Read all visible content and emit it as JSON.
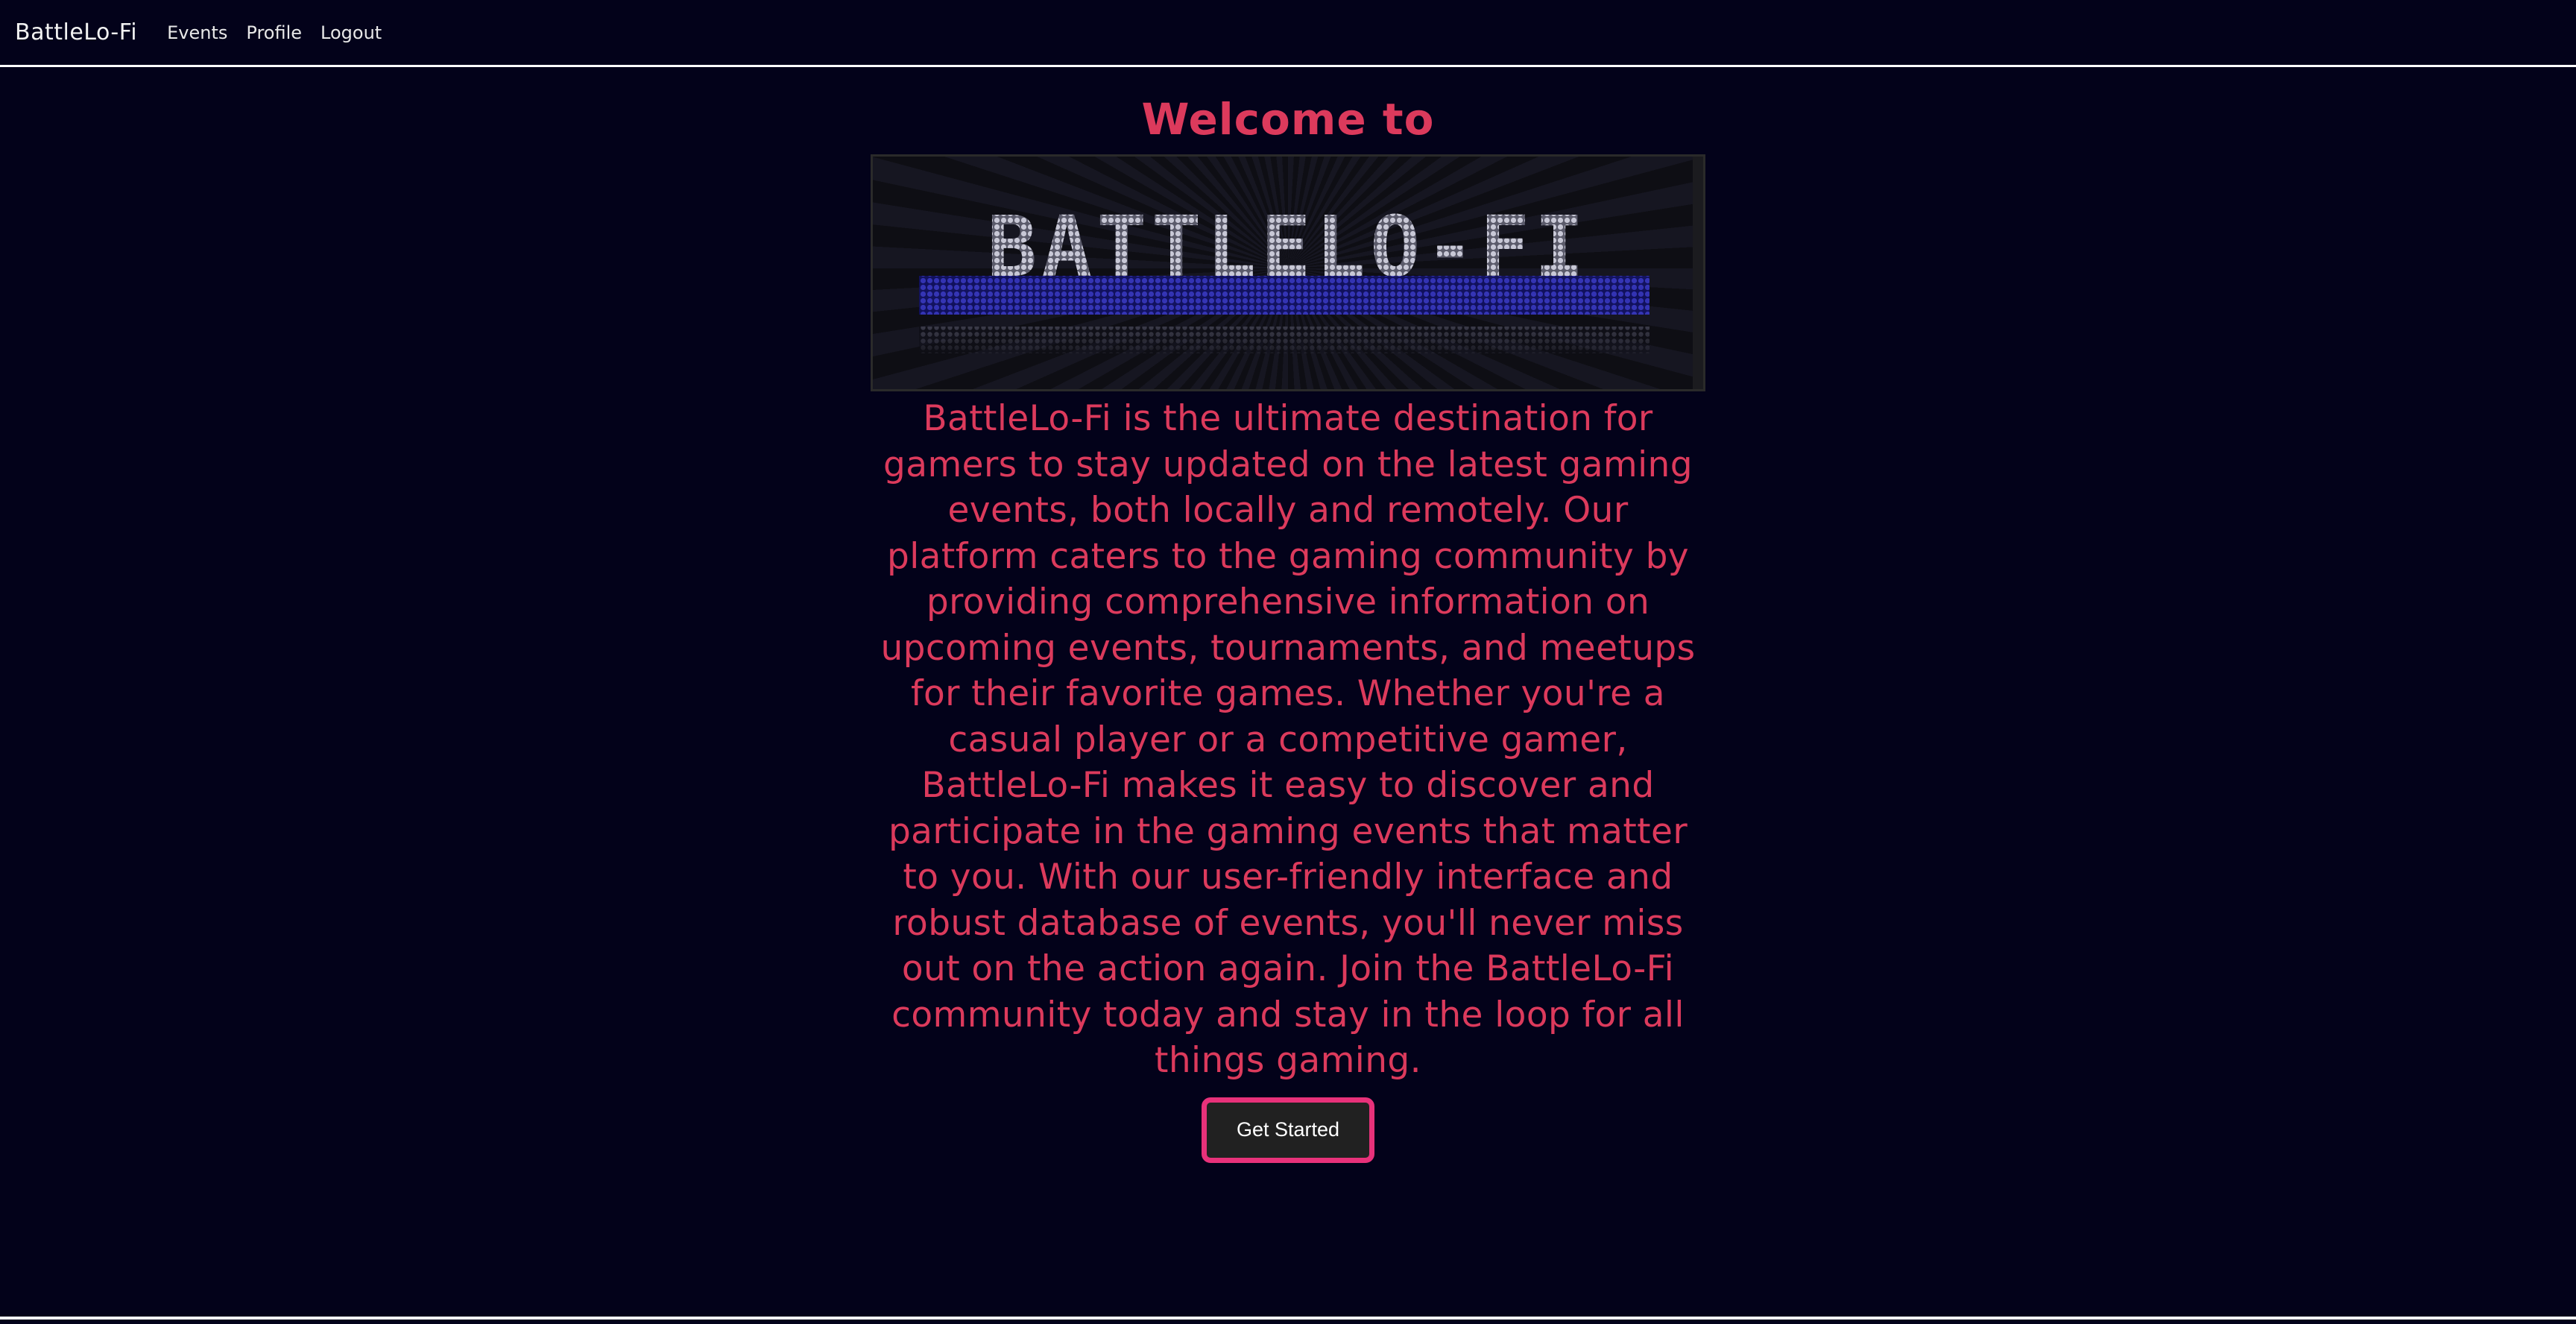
{
  "navbar": {
    "brand": "BattleLo-Fi",
    "links": [
      "Events",
      "Profile",
      "Logout"
    ]
  },
  "hero": {
    "welcome": "Welcome to",
    "logo_text": "BATTLELO-FI",
    "description": "BattleLo-Fi is the ultimate destination for gamers to stay updated on the latest gaming events, both locally and remotely. Our platform caters to the gaming community by providing comprehensive information on upcoming events, tournaments, and meetups for their favorite games. Whether you're a casual player or a competitive gamer, BattleLo-Fi makes it easy to discover and participate in the gaming events that matter to you. With our user-friendly interface and robust database of events, you'll never miss out on the action again. Join the BattleLo-Fi community today and stay in the loop for all things gaming.",
    "cta_label": "Get Started"
  },
  "colors": {
    "background": "#03021a",
    "accent_text": "#dc3a5c",
    "cta_border": "#e8317a",
    "cta_bg": "#212121"
  }
}
